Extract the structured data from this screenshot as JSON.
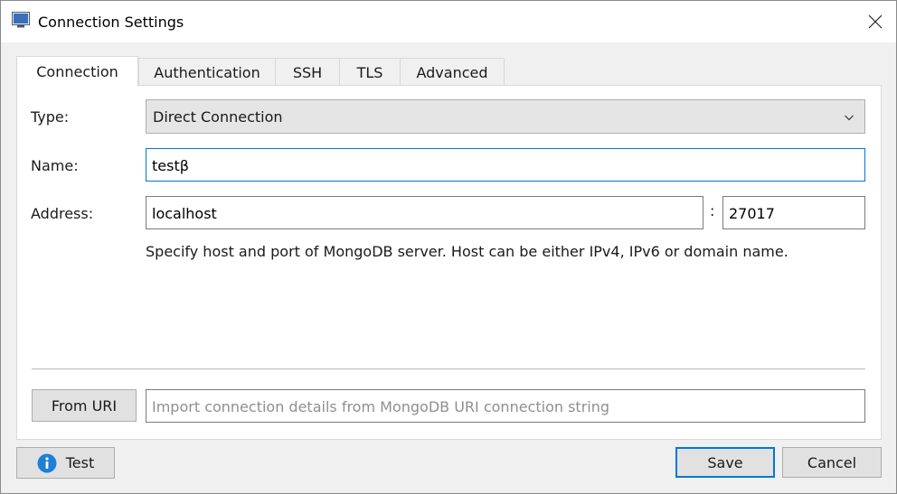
{
  "window": {
    "title": "Connection Settings"
  },
  "tabs": [
    {
      "label": "Connection",
      "active": true
    },
    {
      "label": "Authentication",
      "active": false
    },
    {
      "label": "SSH",
      "active": false
    },
    {
      "label": "TLS",
      "active": false
    },
    {
      "label": "Advanced",
      "active": false
    }
  ],
  "form": {
    "type_label": "Type:",
    "type_value": "Direct Connection",
    "name_label": "Name:",
    "name_value": "testβ",
    "address_label": "Address:",
    "host_value": "localhost",
    "port_separator": ":",
    "port_value": "27017",
    "address_hint": "Specify host and port of MongoDB server. Host can be either IPv4, IPv6 or domain name."
  },
  "uri": {
    "button_label": "From URI",
    "placeholder": "Import connection details from MongoDB URI connection string"
  },
  "footer": {
    "test_label": "Test",
    "save_label": "Save",
    "cancel_label": "Cancel"
  },
  "colors": {
    "accent": "#0078d7",
    "info_icon": "#1e7fd6"
  },
  "icons": {
    "app": "window-icon",
    "close": "close-icon",
    "dropdown": "chevron-down-icon",
    "test": "info-icon"
  }
}
